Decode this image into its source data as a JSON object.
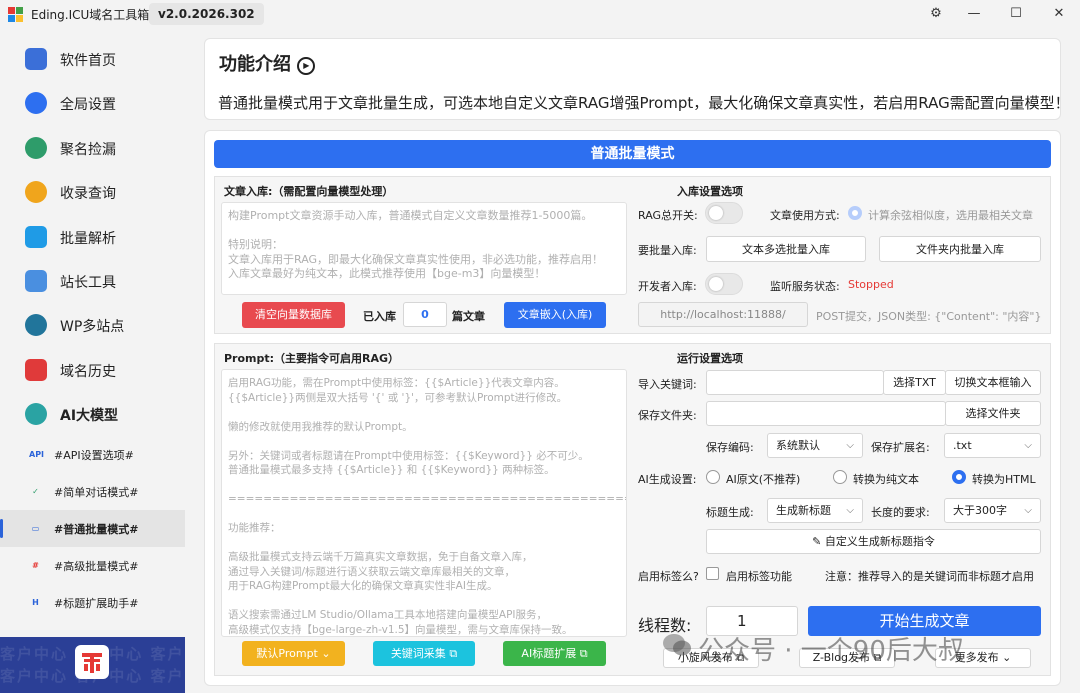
{
  "titlebar": {
    "app_title": "Eding.ICU域名工具箱",
    "version": "v2.0.2026.302",
    "settings_glyph": "⚙",
    "min_glyph": "—",
    "max_glyph": "☐",
    "close_glyph": "✕"
  },
  "sidebar": {
    "items": [
      {
        "label": "软件首页",
        "icon": "home-icon",
        "color": "#3b6fd8"
      },
      {
        "label": "全局设置",
        "icon": "gear-icon",
        "color": "#2d6ff0"
      },
      {
        "label": "聚名捡漏",
        "icon": "landscape-icon",
        "color": "#2e9c6a"
      },
      {
        "label": "收录查询",
        "icon": "magnifier-icon",
        "color": "#f0a51c"
      },
      {
        "label": "批量解析",
        "icon": "cursor-icon",
        "color": "#1f9be6"
      },
      {
        "label": "站长工具",
        "icon": "toolbox-icon",
        "color": "#4a8fe0"
      },
      {
        "label": "WP多站点",
        "icon": "wordpress-icon",
        "color": "#21759b"
      },
      {
        "label": "域名历史",
        "icon": "history-icon",
        "color": "#e03a3a"
      },
      {
        "label": "AI大模型",
        "icon": "openai-icon",
        "color": "#2aa3a3"
      }
    ],
    "subitems": [
      {
        "label": "#API设置选项#",
        "icon_text": "API"
      },
      {
        "label": "#简单对话模式#",
        "icon_text": "✓"
      },
      {
        "label": "#普通批量模式#",
        "icon_text": "▭"
      },
      {
        "label": "#高级批量模式#",
        "icon_text": "#"
      },
      {
        "label": "#标题扩展助手#",
        "icon_text": "H"
      }
    ],
    "banner_watermark": "客户中心 客户中心 客户中心 客户中心"
  },
  "intro": {
    "title": "功能介绍",
    "play_glyph": "▶",
    "text": "普通批量模式用于文章批量生成，可选本地自定义文章RAG增强Prompt，最大化确保文章真实性，若启用RAG需配置向量模型！"
  },
  "mode_title": "普通批量模式",
  "article": {
    "section_title": "文章入库:（需配置向量模型处理）",
    "placeholder": "构建Prompt文章资源手动入库，普通模式自定义文章数量推荐1-5000篇。\n\n特别说明：\n文章入库用于RAG，即最大化确保文章真实性使用，非必选功能，推荐启用！\n入库文章最好为纯文本，此模式推荐使用【bge-m3】向量模型！",
    "clear_btn": "清空向量数据库",
    "stored_label": "已入库",
    "stored_count": "0",
    "unit": "篇文章",
    "embed_btn": "文章嵌入(入库)"
  },
  "store_opts": {
    "title": "入库设置选项",
    "rag_label": "RAG总开关:",
    "usage_label": "文章使用方式:",
    "usage_value": "计算余弦相似度，选用最相关文章",
    "batch_label": "要批量入库:",
    "multi_btn": "文本多选批量入库",
    "folder_btn": "文件夹内批量入库",
    "dev_label": "开发者入库:",
    "listen_label": "监听服务状态:",
    "listen_status": "Stopped",
    "url": "http://localhost:11888/",
    "post_hint": "POST提交，JSON类型: {\"Content\": \"内容\"}"
  },
  "prompt": {
    "section_title": "Prompt:（主要指令可启用RAG）",
    "text": "启用RAG功能，需在Prompt中使用标签：{{$Article}}代表文章内容。\n{{$Article}}两侧是双大括号 '{' 或 '}'，可参考默认Prompt进行修改。\n\n懒的修改就使用我推荐的默认Prompt。\n\n另外：关键词或者标题请在Prompt中使用标签：{{$Keyword}} 必不可少。\n普通批量模式最多支持 {{$Article}} 和 {{$Keyword}} 两种标签。\n\n===============================================\n\n功能推荐：\n\n高级批量模式支持云端千万篇真实文章数据，免于自备文章入库，\n通过导入关键词/标题进行语义获取云端文章库最相关的文章，\n用于RAG构建Prompt最大化的确保文章真实性非AI生成。\n\n语义搜索需通过LM Studio/Ollama工具本地搭建向量模型API服务，\n高级模式仅支持【bge-large-zh-v1.5】向量模型，需与文章库保持一致。",
    "default_btn": "默认Prompt",
    "keyword_btn": "关键词采集",
    "ai_title_btn": "AI标题扩展"
  },
  "run": {
    "title": "运行设置选项",
    "kw_label": "导入关键词:",
    "kw_value": "",
    "choose_txt": "选择TXT",
    "switch_box": "切换文本框输入",
    "folder_label": "保存文件夹:",
    "folder_value": "",
    "choose_folder": "选择文件夹",
    "enc_label": "保存编码:",
    "enc_value": "系统默认",
    "ext_label": "保存扩展名:",
    "ext_value": ".txt",
    "ai_label": "AI生成设置:",
    "radio1": "AI原文(不推荐)",
    "radio2": "转换为纯文本",
    "radio3": "转换为HTML",
    "title_label": "标题生成:",
    "title_value": "生成新标题",
    "len_label": "长度的要求:",
    "len_value": "大于300字",
    "custom_btn": "自定义生成新标题指令",
    "tag_label": "启用标签么?",
    "tag_chk": "启用标签功能",
    "note": "注意：推荐导入的是关键词而非标题才启用",
    "threads_label": "线程数:",
    "threads_value": "1",
    "start_btn": "开始生成文章",
    "pub1": "小旋风发布",
    "pub2": "Z-Blog发布",
    "pub3": "更多发布"
  },
  "overlay_watermark": "公众号 · 一个90后大叔"
}
